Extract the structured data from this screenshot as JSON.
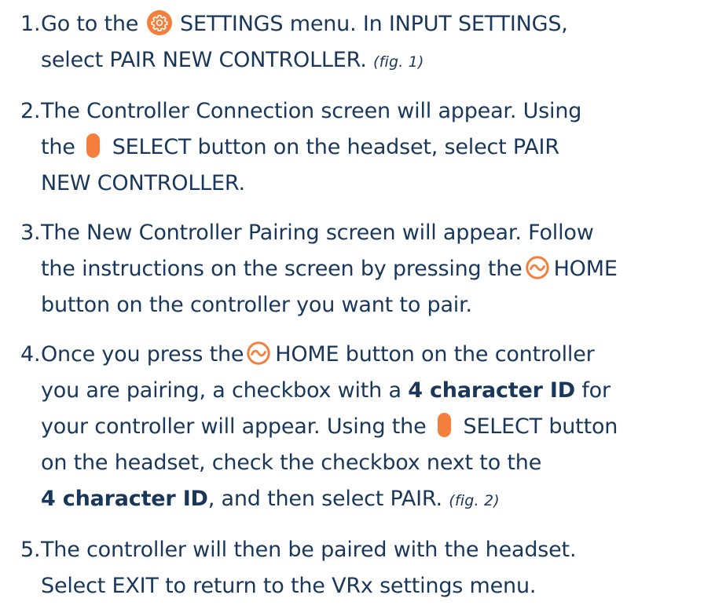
{
  "colors": {
    "text": "#19375a",
    "accent": "#f47f3c"
  },
  "icons": {
    "settings": "gear-icon",
    "select": "select-button-icon",
    "home": "home-button-icon"
  },
  "steps": [
    {
      "number": "1.",
      "line1_a": "Go to the",
      "line1_b": "SETTINGS menu. In INPUT SETTINGS,",
      "line2": "select PAIR NEW CONTROLLER.",
      "fig": "(fig. 1)"
    },
    {
      "number": "2.",
      "line1": "The Controller Connection screen will appear. Using",
      "line2_a": "the",
      "line2_b": "SELECT button on the headset, select PAIR",
      "line3": "NEW CONTROLLER."
    },
    {
      "number": "3.",
      "line1": "The New Controller Pairing screen will appear. Follow",
      "line2_a": "the instructions on the screen by pressing the",
      "line2_b": "HOME",
      "line3": "button on the controller you want to pair."
    },
    {
      "number": "4.",
      "line1_a": "Once you press the",
      "line1_b": "HOME button on the controller",
      "line2_a": "you are pairing, a checkbox with a",
      "line2_bold": "4 character ID",
      "line2_b": "for",
      "line3_a": "your controller will appear. Using the",
      "line3_b": "SELECT button",
      "line4": "on the headset, check the checkbox next to the",
      "line5_bold": "4 character ID",
      "line5_a": ", and then select PAIR.",
      "fig": "(fig. 2)"
    },
    {
      "number": "5.",
      "line1": "The controller will then be paired with the headset.",
      "line2": "Select EXIT to return to the VRx settings menu."
    }
  ]
}
